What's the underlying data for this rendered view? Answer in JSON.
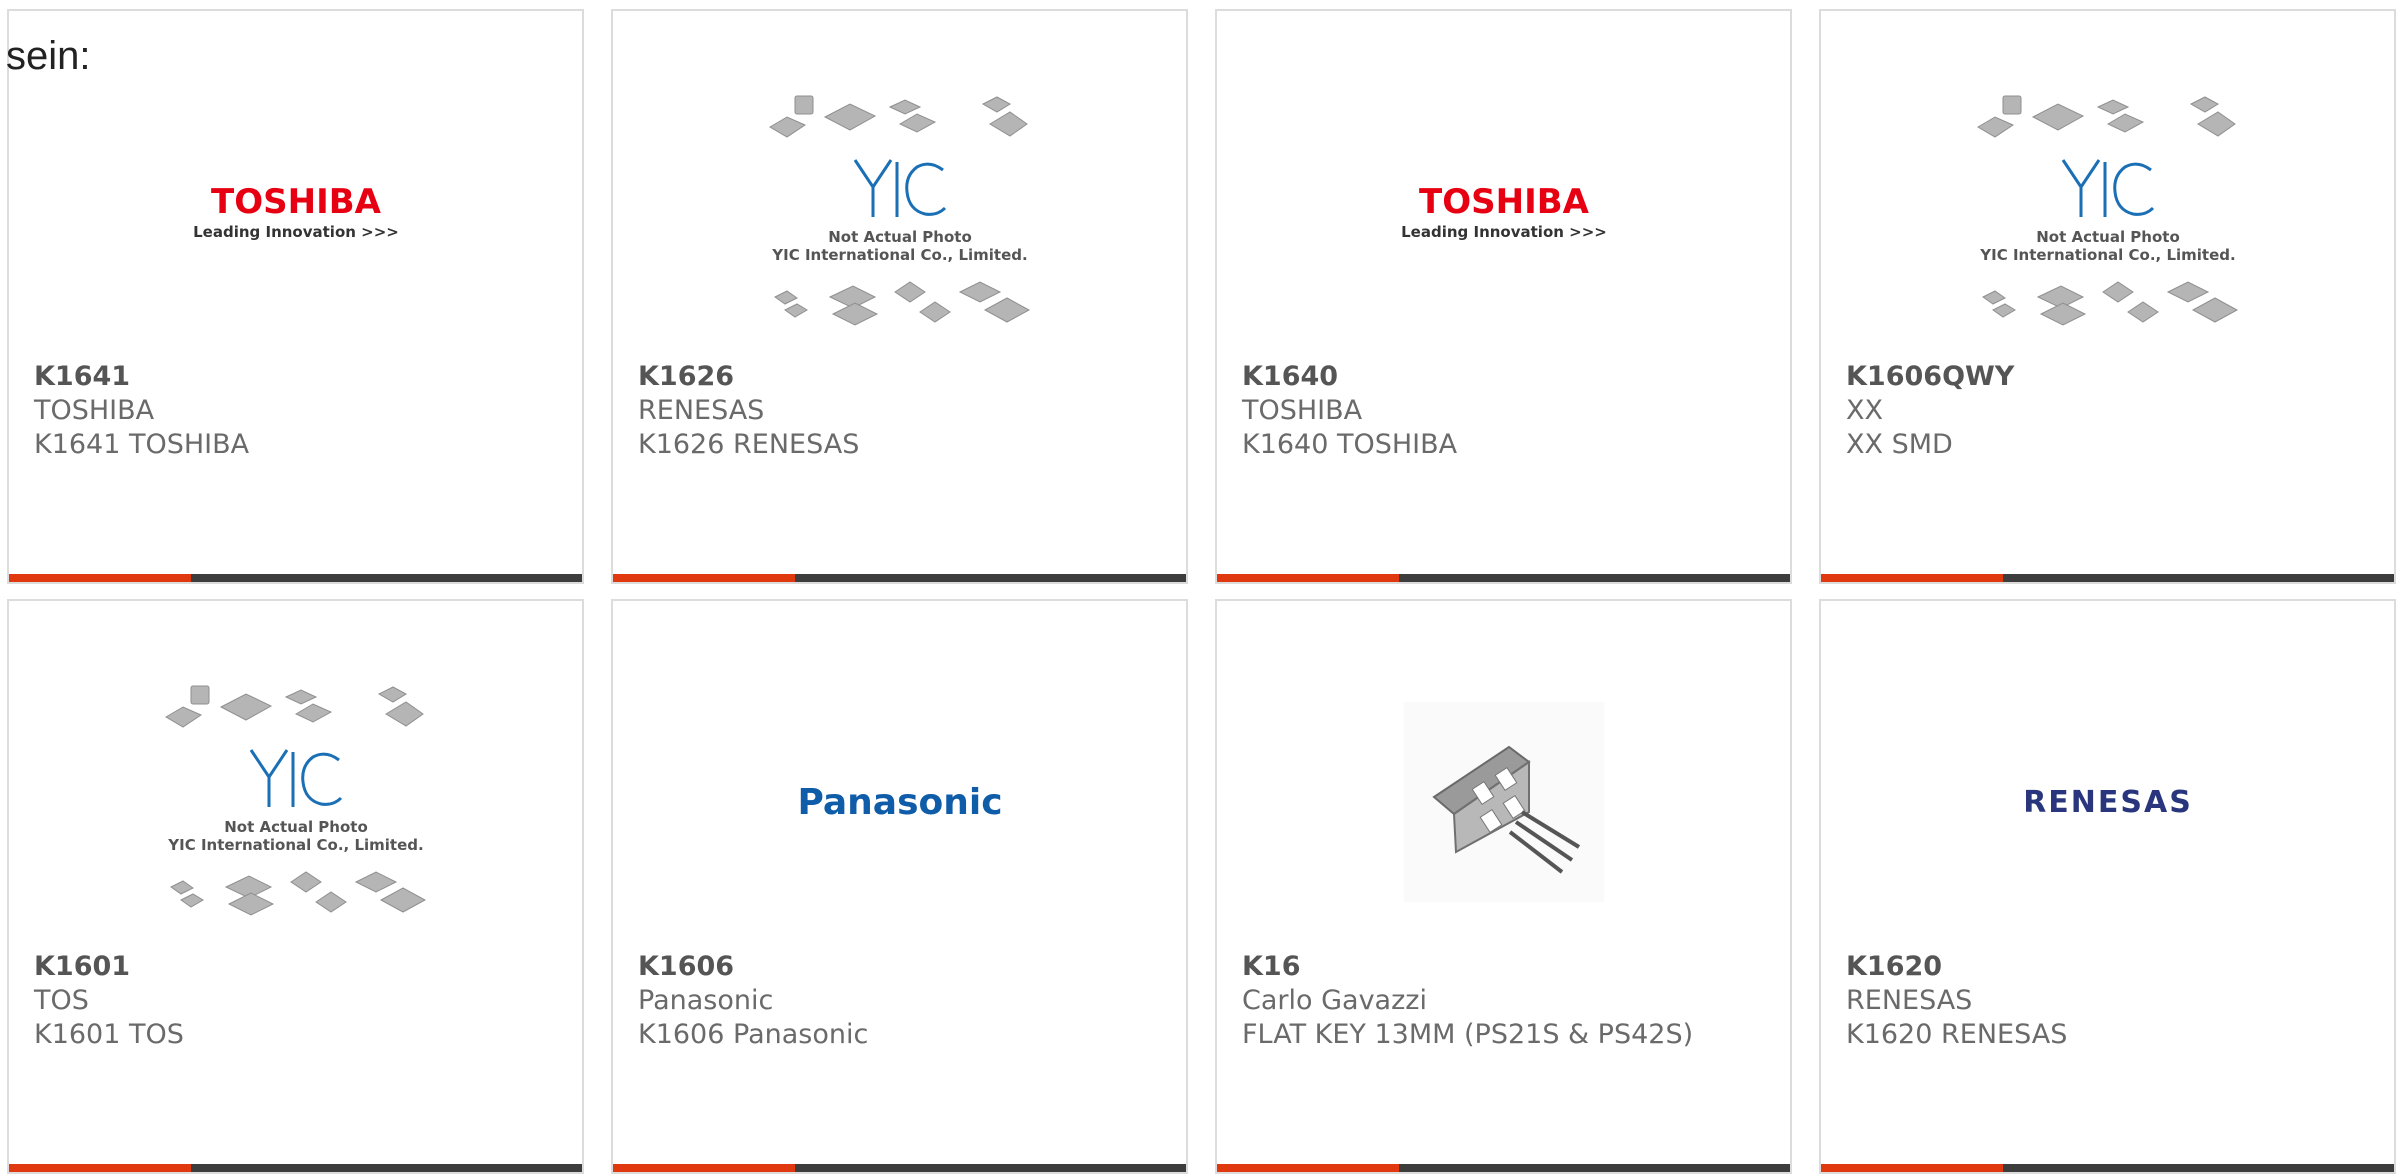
{
  "intro_text": "sein:",
  "products": [
    {
      "part": "K1641",
      "brand": "TOSHIBA",
      "desc": "K1641 TOSHIBA",
      "image": "toshiba-logo",
      "image_text": {
        "line1": "TOSHIBA",
        "line2": "Leading Innovation >>>"
      }
    },
    {
      "part": "K1626",
      "brand": "RENESAS",
      "desc": "K1626 RENESAS",
      "image": "yic-placeholder",
      "image_text": {
        "logo": "YIC",
        "line1": "Not Actual Photo",
        "line2": "YIC International Co., Limited."
      }
    },
    {
      "part": "K1640",
      "brand": "TOSHIBA",
      "desc": "K1640 TOSHIBA",
      "image": "toshiba-logo",
      "image_text": {
        "line1": "TOSHIBA",
        "line2": "Leading Innovation >>>"
      }
    },
    {
      "part": "K1606QWY",
      "brand": "XX",
      "desc": "XX SMD",
      "image": "yic-placeholder",
      "image_text": {
        "logo": "YIC",
        "line1": "Not Actual Photo",
        "line2": "YIC International Co., Limited."
      }
    },
    {
      "part": "K1601",
      "brand": "TOS",
      "desc": "K1601 TOS",
      "image": "yic-placeholder",
      "image_text": {
        "logo": "YIC",
        "line1": "Not Actual Photo",
        "line2": "YIC International Co., Limited."
      }
    },
    {
      "part": "K1606",
      "brand": "Panasonic",
      "desc": "K1606 Panasonic",
      "image": "panasonic-logo",
      "image_text": {
        "line1": "Panasonic"
      }
    },
    {
      "part": "K16",
      "brand": "Carlo Gavazzi",
      "desc": "FLAT KEY 13MM (PS21S & PS42S)",
      "image": "flat-key-photo",
      "image_text": {}
    },
    {
      "part": "K1620",
      "brand": "RENESAS",
      "desc": "K1620 RENESAS",
      "image": "renesas-logo",
      "image_text": {
        "line1": "RENESAS"
      }
    }
  ],
  "colors": {
    "accent_bar": "#e0380f",
    "dark_bar": "#3d3d3d",
    "toshiba_red": "#e60012",
    "panasonic_blue": "#0f5ca8",
    "renesas_navy": "#29367d",
    "yic_blue": "#1a6fb5"
  }
}
